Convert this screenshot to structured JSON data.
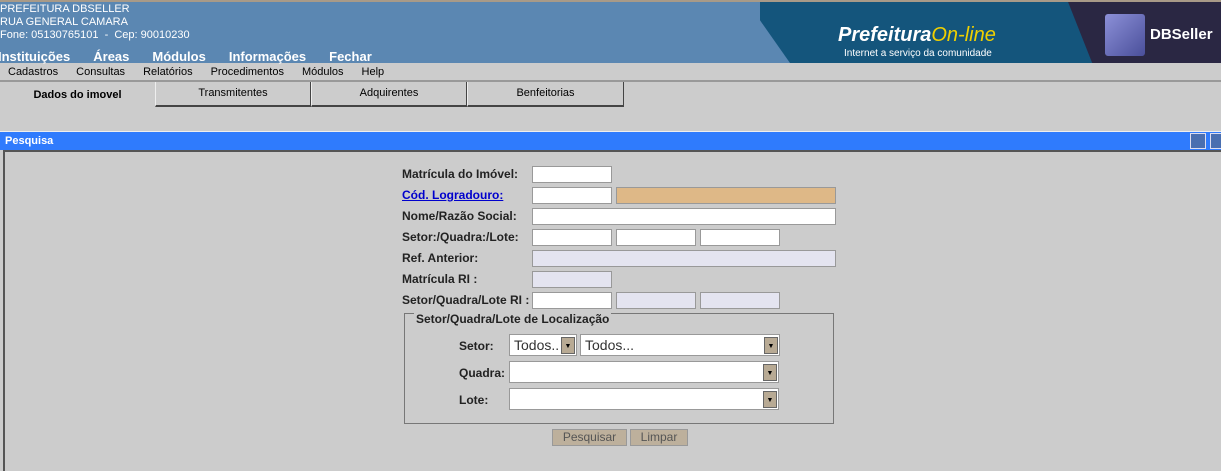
{
  "header": {
    "org": "PREFEITURA DBSELLER",
    "address": "RUA GENERAL CAMARA",
    "contact": "Fone: 05130765101  -  Cep: 90010230",
    "menu": [
      "Instituições",
      "Áreas",
      "Módulos",
      "Informações",
      "Fechar"
    ],
    "banner": {
      "logo_main": "Prefeitura",
      "logo_accent": "On-line",
      "tagline": "Internet a serviço da comunidade",
      "brand": "DBSeller"
    }
  },
  "submenu": [
    "Cadastros",
    "Consultas",
    "Relatórios",
    "Procedimentos",
    "Módulos",
    "Help"
  ],
  "tabs": [
    "Dados do imovel",
    "Transmitentes",
    "Adquirentes",
    "Benfeitorias"
  ],
  "window": {
    "title": "Pesquisa"
  },
  "form": {
    "matricula": "Matrícula do Imóvel:",
    "cod_logradouro": "Cód. Logradouro:",
    "nome": "Nome/Razão Social:",
    "setor_quadra_lote": "Setor:/Quadra:/Lote:",
    "ref_anterior": "Ref. Anterior:",
    "matricula_ri": "Matrícula RI :",
    "sql_ri": "Setor/Quadra/Lote RI :",
    "fieldset": {
      "legend": "Setor/Quadra/Lote de Localização",
      "setor": "Setor:",
      "quadra": "Quadra:",
      "lote": "Lote:",
      "setor_value1": "Todos..",
      "setor_value2": "Todos..."
    },
    "search_button": "Pesquisar",
    "clear_button": "Limpar"
  },
  "colors": {
    "header": "#5b87b2",
    "titlebar": "#2f7bfd"
  }
}
